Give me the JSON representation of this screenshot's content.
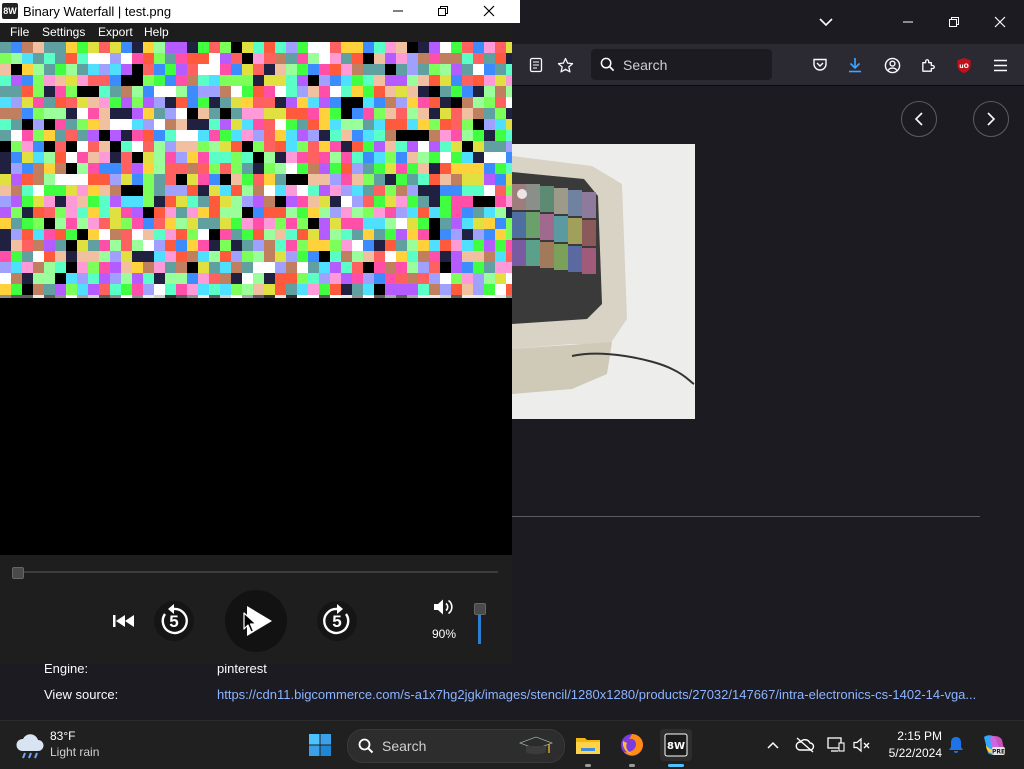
{
  "browser": {
    "search_placeholder": "Search",
    "meta": {
      "engine_label": "Engine:",
      "engine_value": "pinterest",
      "source_label": "View source:",
      "source_link": "https://cdn11.bigcommerce.com/s-a1x7hg2jgk/images/stencil/1280x1280/products/27032/147667/intra-electronics-cs-1402-14-vga..."
    }
  },
  "app": {
    "title": "Binary Waterfall | test.png",
    "logo_text": "8W",
    "menu": [
      "File",
      "Settings",
      "Export",
      "Help"
    ],
    "controls": {
      "rewind_seconds": "5",
      "forward_seconds": "5",
      "volume_label": "90%",
      "volume_fraction": 0.9,
      "seek_fraction": 0.0
    }
  },
  "taskbar": {
    "weather_temp": "83°F",
    "weather_desc": "Light rain",
    "search_placeholder": "Search",
    "clock_time": "2:15 PM",
    "clock_date": "5/22/2024"
  },
  "colors": {
    "link": "#8cb4ff",
    "download_accent": "#3fa7ff",
    "ublock_red": "#c0101a",
    "volume_blue": "#2a7fd4",
    "notify_blue": "#1c74e8"
  }
}
